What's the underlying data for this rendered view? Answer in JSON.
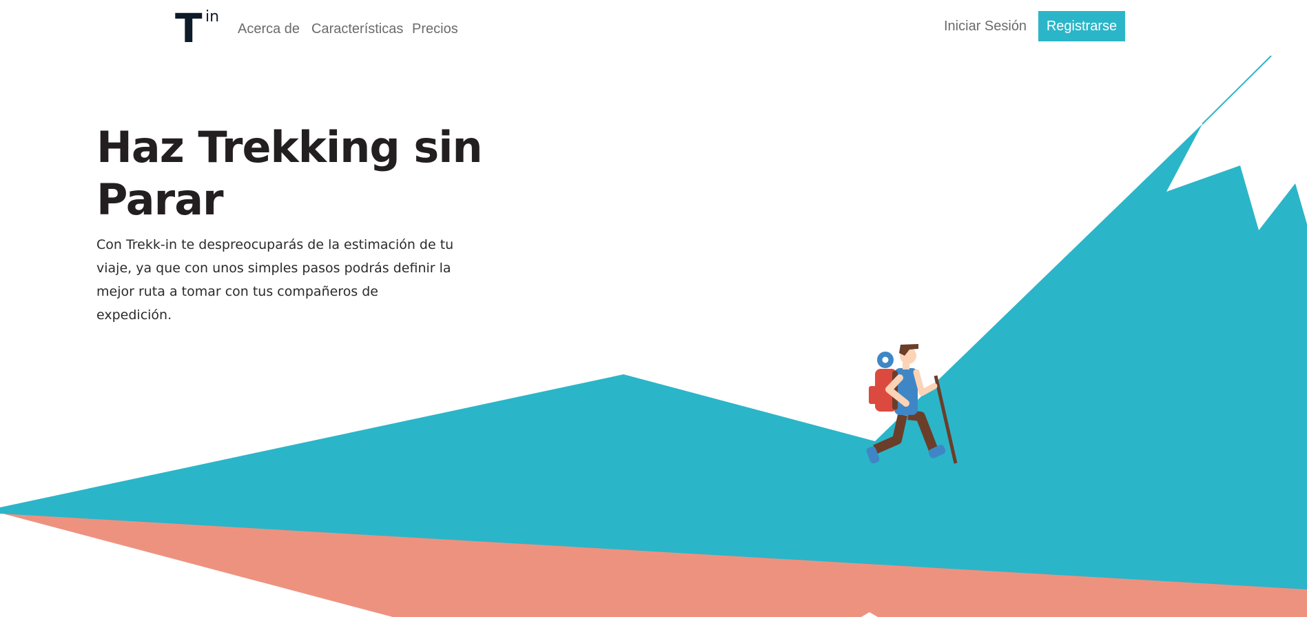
{
  "nav": {
    "logo": {
      "letter": "T",
      "superscript": "in"
    },
    "links": [
      "Acerca de",
      "Características",
      "Precios"
    ],
    "login_label": "Iniciar Sesión",
    "signup_label": "Registrarse"
  },
  "hero": {
    "title": "Haz Trekking sin Parar",
    "description": "Con Trekk-in te despreocuparás de la estimación de tu viaje, ya que con unos simples pasos podrás definir la mejor ruta a tomar con tus compañeros de expedición."
  },
  "colors": {
    "accent": "#2bb5c8",
    "mountain": "#2bb5c8",
    "ground": "#ee9280",
    "text_dark": "#231f20",
    "nav_text": "#6b6b6b",
    "backpack": "#dc4a3f",
    "shirt": "#3f86c6",
    "pants": "#6b3e2a",
    "skin": "#fcd3b6",
    "boots": "#3f86c6"
  },
  "icons": [
    "hiker-illustration",
    "mountain-illustration"
  ]
}
